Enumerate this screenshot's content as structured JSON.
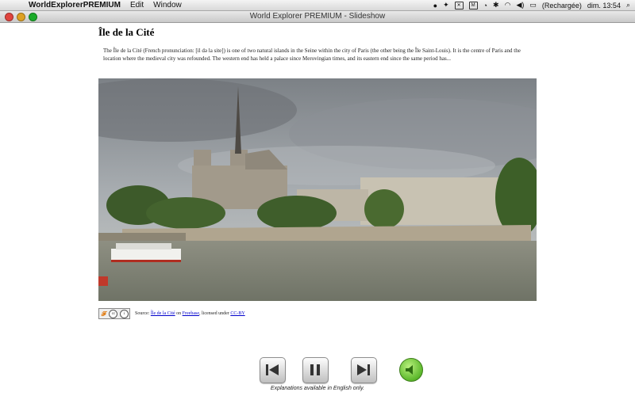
{
  "menubar": {
    "app_name": "WorldExplorerPREMIUM",
    "menus": [
      "Edit",
      "Window"
    ],
    "battery_status": "(Rechargée)",
    "clock": "dim. 13:54"
  },
  "window": {
    "title": "World Explorer PREMIUM - Slideshow"
  },
  "article": {
    "title": "Île de la Cité",
    "description": "The Île de la Cité (French pronunciation: [il də la site]) is one of two natural islands in the Seine within the city of Paris (the other being the Île Saint-Louis). It is the centre of Paris and the location where the medieval city was refounded. The western end has held a palace since Merovingian times, and its eastern end since the same period has..."
  },
  "source": {
    "prefix": "Source:",
    "link_title": "Île de la Cité",
    "on": "on",
    "link_site": "Freebase",
    "licensed": ", licensed under",
    "link_license": "CC-BY"
  },
  "controls": {
    "icons": [
      "previous-icon",
      "pause-icon",
      "next-icon",
      "speaker-icon"
    ],
    "note": "Explanations available in English only."
  }
}
